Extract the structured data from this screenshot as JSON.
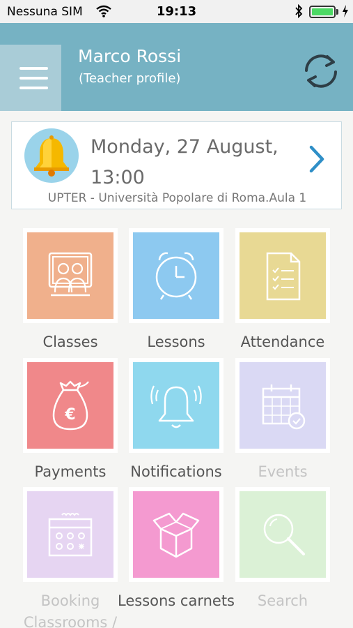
{
  "status_bar": {
    "carrier": "Nessuna SIM",
    "time": "19:13",
    "battery_level": 1.0
  },
  "header": {
    "user_name": "Marco Rossi",
    "user_role": "(Teacher profile)",
    "background_color": "#76b2c3",
    "menu_icon": "hamburger-menu-icon",
    "refresh_icon": "refresh-icon"
  },
  "next_lesson": {
    "date": "Monday, 27 August,",
    "time": "13:00",
    "location": "UPTER - Università Popolare di Roma.Aula 1",
    "icon": "bell-icon"
  },
  "tiles": [
    {
      "label": "Classes",
      "color": "#f0b08c",
      "icon": "classroom-icon",
      "enabled": true
    },
    {
      "label": "Lessons",
      "color": "#8dc9f0",
      "icon": "alarm-clock-icon",
      "enabled": true
    },
    {
      "label": "Attendance",
      "color": "#e8d994",
      "icon": "checklist-document-icon",
      "enabled": true
    },
    {
      "label": "Payments",
      "color": "#f0888a",
      "icon": "money-bag-icon",
      "enabled": true
    },
    {
      "label": "Notifications",
      "color": "#8fd8ee",
      "icon": "bell-ringing-icon",
      "enabled": true
    },
    {
      "label": "Events",
      "color": "#dad9f4",
      "icon": "calendar-check-icon",
      "enabled": false
    },
    {
      "label": "Booking Classrooms /",
      "color": "#e6d5f2",
      "icon": "booking-calendar-icon",
      "enabled": false
    },
    {
      "label": "Lessons carnets",
      "color": "#f49ad0",
      "icon": "box-icon",
      "enabled": true
    },
    {
      "label": "Search",
      "color": "#dbf1d6",
      "icon": "search-icon",
      "enabled": false
    }
  ]
}
